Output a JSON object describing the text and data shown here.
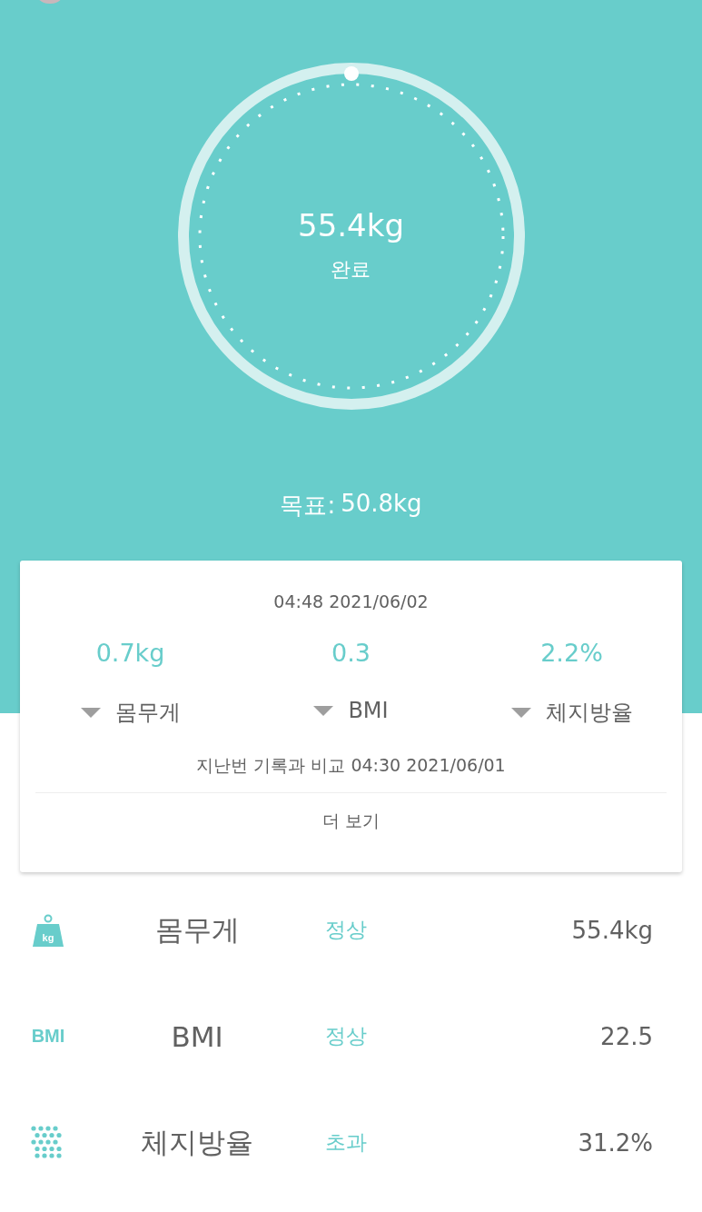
{
  "gauge": {
    "value": "55.4kg",
    "status": "완료"
  },
  "goal": {
    "label": "목표:",
    "value": "50.8kg"
  },
  "summary": {
    "timestamp": "04:48 2021/06/02",
    "changes": [
      {
        "value": "0.7kg",
        "decreased": true,
        "label": "몸무게"
      },
      {
        "value": "0.3",
        "decreased": true,
        "label": "BMI"
      },
      {
        "value": "2.2%",
        "decreased": true,
        "label": "체지방율"
      }
    ],
    "comparison": "지난번 기록과 비교 04:30 2021/06/01",
    "more_button": "더 보기"
  },
  "metrics": [
    {
      "kind": "weight",
      "icon_text": "kg",
      "name": "몸무게",
      "status": "정상",
      "value": "55.4kg"
    },
    {
      "kind": "bmi",
      "icon_text": "BMI",
      "name": "BMI",
      "status": "정상",
      "value": "22.5"
    },
    {
      "kind": "fat",
      "name": "체지방율",
      "status": "초과",
      "value": "31.2%"
    }
  ]
}
